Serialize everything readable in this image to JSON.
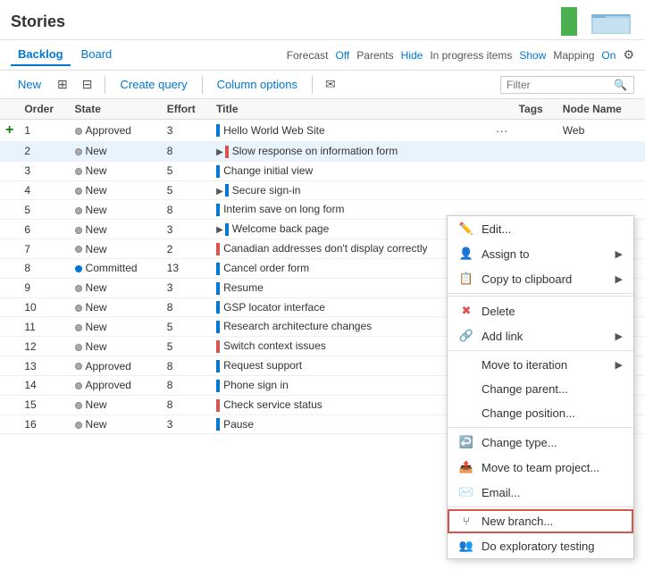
{
  "header": {
    "title": "Stories",
    "green_bar": true
  },
  "nav": {
    "tabs": [
      {
        "label": "Backlog",
        "active": true
      },
      {
        "label": "Board",
        "active": false
      }
    ],
    "forecast_label": "Forecast",
    "forecast_value": "Off",
    "parents_label": "Parents",
    "parents_value": "Hide",
    "in_progress_label": "In progress items",
    "in_progress_value": "Show",
    "mapping_label": "Mapping",
    "mapping_value": "On"
  },
  "toolbar": {
    "new_label": "New",
    "create_query_label": "Create query",
    "column_options_label": "Column options",
    "filter_placeholder": "Filter"
  },
  "table": {
    "columns": [
      "",
      "Order",
      "State",
      "Effort",
      "Title",
      "",
      "Tags",
      "Node Name"
    ],
    "rows": [
      {
        "order": "1",
        "state": "Approved",
        "state_dot": "grey",
        "effort": "3",
        "bar_color": "blue",
        "title": "Hello World Web Site",
        "tags": "",
        "node": "Web",
        "has_dots": true
      },
      {
        "order": "2",
        "state": "New",
        "state_dot": "grey",
        "effort": "8",
        "bar_color": "red",
        "title": "Slow response on information form",
        "tags": "",
        "node": "",
        "expandable": true,
        "highlighted": true
      },
      {
        "order": "3",
        "state": "New",
        "state_dot": "grey",
        "effort": "5",
        "bar_color": "blue",
        "title": "Change initial view",
        "tags": "",
        "node": ""
      },
      {
        "order": "4",
        "state": "New",
        "state_dot": "grey",
        "effort": "5",
        "bar_color": "blue",
        "title": "Secure sign-in",
        "tags": "",
        "node": "",
        "expandable": true
      },
      {
        "order": "5",
        "state": "New",
        "state_dot": "grey",
        "effort": "8",
        "bar_color": "blue",
        "title": "Interim save on long form",
        "tags": "",
        "node": ""
      },
      {
        "order": "6",
        "state": "New",
        "state_dot": "grey",
        "effort": "3",
        "bar_color": "blue",
        "title": "Welcome back page",
        "tags": "",
        "node": "",
        "expandable": true
      },
      {
        "order": "7",
        "state": "New",
        "state_dot": "grey",
        "effort": "2",
        "bar_color": "red",
        "title": "Canadian addresses don't display correctly",
        "tags": "",
        "node": ""
      },
      {
        "order": "8",
        "state": "Committed",
        "state_dot": "blue",
        "effort": "13",
        "bar_color": "blue",
        "title": "Cancel order form",
        "tags": "",
        "node": ""
      },
      {
        "order": "9",
        "state": "New",
        "state_dot": "grey",
        "effort": "3",
        "bar_color": "blue",
        "title": "Resume",
        "tags": "",
        "node": ""
      },
      {
        "order": "10",
        "state": "New",
        "state_dot": "grey",
        "effort": "8",
        "bar_color": "blue",
        "title": "GSP locator interface",
        "tags": "",
        "node": ""
      },
      {
        "order": "11",
        "state": "New",
        "state_dot": "grey",
        "effort": "5",
        "bar_color": "blue",
        "title": "Research architecture changes",
        "tags": "",
        "node": ""
      },
      {
        "order": "12",
        "state": "New",
        "state_dot": "grey",
        "effort": "5",
        "bar_color": "red",
        "title": "Switch context issues",
        "tags": "",
        "node": ""
      },
      {
        "order": "13",
        "state": "Approved",
        "state_dot": "grey",
        "effort": "8",
        "bar_color": "blue",
        "title": "Request support",
        "tags": "",
        "node": ""
      },
      {
        "order": "14",
        "state": "Approved",
        "state_dot": "grey",
        "effort": "8",
        "bar_color": "blue",
        "title": "Phone sign in",
        "tags": "",
        "node": ""
      },
      {
        "order": "15",
        "state": "New",
        "state_dot": "grey",
        "effort": "8",
        "bar_color": "red",
        "title": "Check service status",
        "tags": "",
        "node": ""
      },
      {
        "order": "16",
        "state": "New",
        "state_dot": "grey",
        "effort": "3",
        "bar_color": "blue",
        "title": "Pause",
        "tags": "",
        "node": ""
      }
    ]
  },
  "context_menu": {
    "items": [
      {
        "id": "edit",
        "label": "Edit...",
        "icon": "✏️",
        "type": "normal"
      },
      {
        "id": "assign-to",
        "label": "Assign to",
        "icon": "👤",
        "type": "submenu"
      },
      {
        "id": "copy-clipboard",
        "label": "Copy to clipboard",
        "icon": "📋",
        "type": "submenu"
      },
      {
        "id": "delete",
        "label": "Delete",
        "icon": "✖",
        "type": "delete"
      },
      {
        "id": "add-link",
        "label": "Add link",
        "icon": "🔗",
        "type": "submenu"
      },
      {
        "id": "move-iteration",
        "label": "Move to iteration",
        "icon": "",
        "type": "submenu"
      },
      {
        "id": "change-parent",
        "label": "Change parent...",
        "icon": "",
        "type": "normal"
      },
      {
        "id": "change-position",
        "label": "Change position...",
        "icon": "",
        "type": "normal"
      },
      {
        "id": "change-type",
        "label": "Change type...",
        "icon": "↩️",
        "type": "normal"
      },
      {
        "id": "move-team",
        "label": "Move to team project...",
        "icon": "📤",
        "type": "normal"
      },
      {
        "id": "email",
        "label": "Email...",
        "icon": "✉️",
        "type": "normal"
      },
      {
        "id": "new-branch",
        "label": "New branch...",
        "icon": "⑂",
        "type": "highlighted"
      },
      {
        "id": "exploratory",
        "label": "Do exploratory testing",
        "icon": "👥",
        "type": "normal"
      }
    ]
  }
}
